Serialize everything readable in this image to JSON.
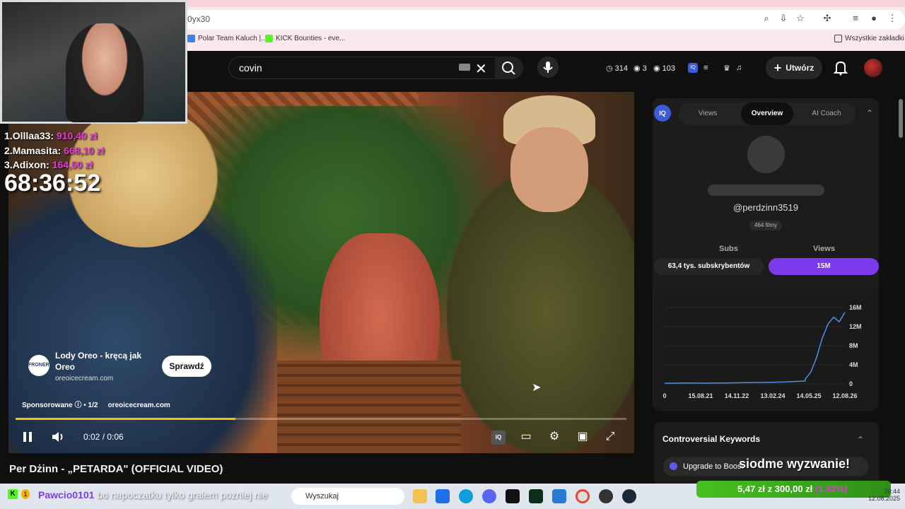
{
  "browser": {
    "url": "0yx30",
    "bookmarks": [
      {
        "label": "Polar Team Kaluch |...",
        "color": "#3b82f6"
      },
      {
        "label": "KICK Bounties - eve...",
        "color": "#53fc18"
      }
    ],
    "bookmarks_folder": "Wszystkie zakładki"
  },
  "yt_header": {
    "search_value": "covin",
    "stats": {
      "clock": "314",
      "eye1": "3",
      "eye2": "103"
    },
    "create_label": "Utwórz"
  },
  "stream_overlay": {
    "leaderboard": [
      {
        "rank": "1.",
        "name": "Olllaa33:",
        "amount": "910,40 zł"
      },
      {
        "rank": "2.",
        "name": "Mamasita:",
        "amount": "668,10 zł"
      },
      {
        "rank": "3.",
        "name": "Adixon:",
        "amount": "164,50 zł"
      }
    ],
    "timer": "68:36:52",
    "chat": {
      "user": "Pawcio0101",
      "message": "bo napoczatku tylko gralem pozniej nie"
    },
    "challenge": "siodme wyzwanie!",
    "donation": {
      "current": "5,47 zł",
      "sep": "z",
      "goal": "300,00 zł",
      "pct": "(1.82%)"
    }
  },
  "ad": {
    "title": "Lody Oreo - kręcą jak Oreo",
    "domain": "oreoicecream.com",
    "logo": "FRONERI",
    "cta": "Sprawdź",
    "meta": "Sponsorowane",
    "counter": "1/2",
    "meta_domain": "oreoicecream.com"
  },
  "player": {
    "time": "0:02 / 0:06",
    "progress": 0.36
  },
  "video_title": "Per Dżinn - „PETARDA\" (OFFICIAL VIDEO)",
  "vidiq": {
    "logo": "IQ",
    "tabs": [
      "Views",
      "Overview",
      "AI Coach"
    ],
    "active_tab": "Overview",
    "handle": "@perdzinn3519",
    "films": "464 filmy",
    "subs_label": "Subs",
    "views_label": "Views",
    "subs_value": "63,4 tys. subskrybentów",
    "views_value": "15M",
    "keywords_title": "Controversial Keywords",
    "upgrade_label": "Upgrade to Boost"
  },
  "chart_data": {
    "type": "line",
    "x_ticks": [
      "0",
      "15.08.21",
      "14.11.22",
      "13.02.24",
      "14.05.25",
      "12.08.26"
    ],
    "y_ticks": [
      "0",
      "4M",
      "8M",
      "12M",
      "16M"
    ],
    "ylim": [
      0,
      16
    ],
    "series": [
      {
        "values": [
          0.1,
          0.2,
          0.15,
          0.2,
          0.25,
          0.3,
          0.4,
          0.6,
          1.0,
          2.5,
          5.5,
          9.5,
          12.5,
          14.0,
          13.0,
          15.0
        ]
      }
    ],
    "color": "#4a90e2"
  },
  "taskbar": {
    "search_placeholder": "Wyszukaj",
    "clock_time": "20:44",
    "clock_date": "12.08.2025"
  }
}
